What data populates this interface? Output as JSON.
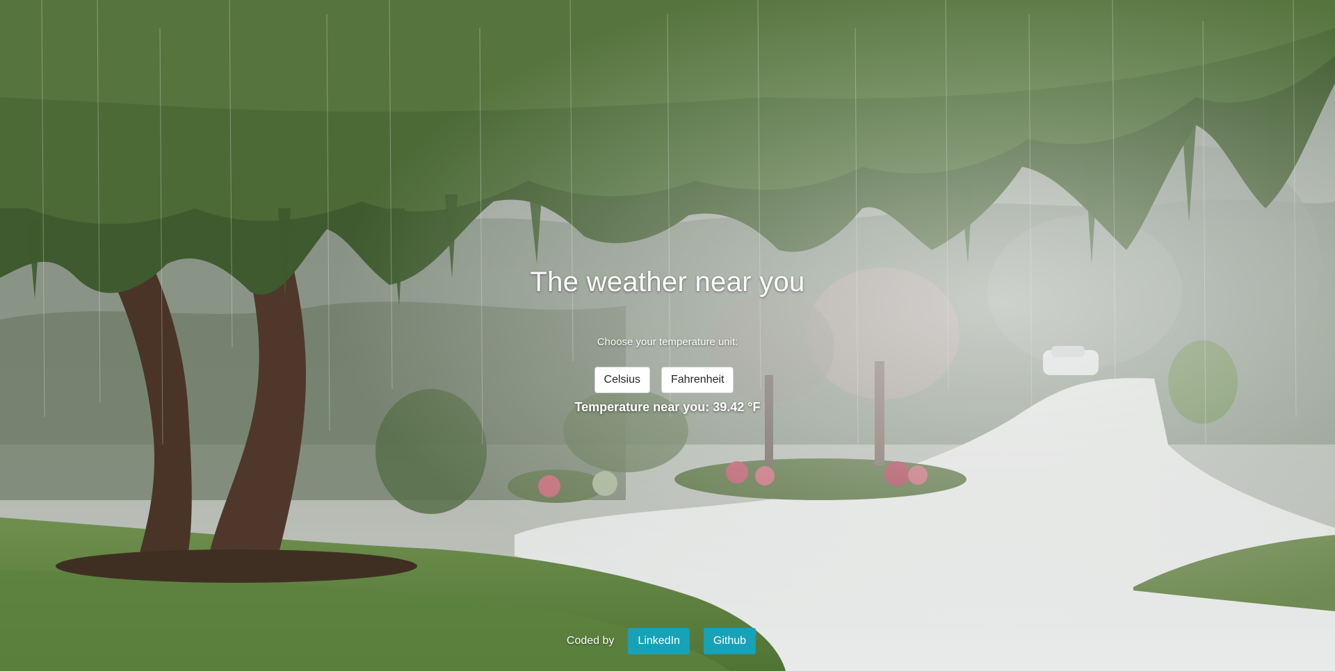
{
  "page": {
    "title": "The weather near you",
    "unit_prompt": "Choose your temperature unit:",
    "units": {
      "celsius_label": "Celsius",
      "fahrenheit_label": "Fahrenheit"
    },
    "temperature": {
      "label": "Temperature near you:",
      "value": "39.42",
      "unit_symbol": "°F"
    }
  },
  "footer": {
    "coded_by": "Coded by",
    "linkedin_label": "LinkedIn",
    "github_label": "Github"
  },
  "colors": {
    "link_button": "#17a2b8",
    "unit_button": "#ffffff",
    "text": "#ffffff"
  }
}
